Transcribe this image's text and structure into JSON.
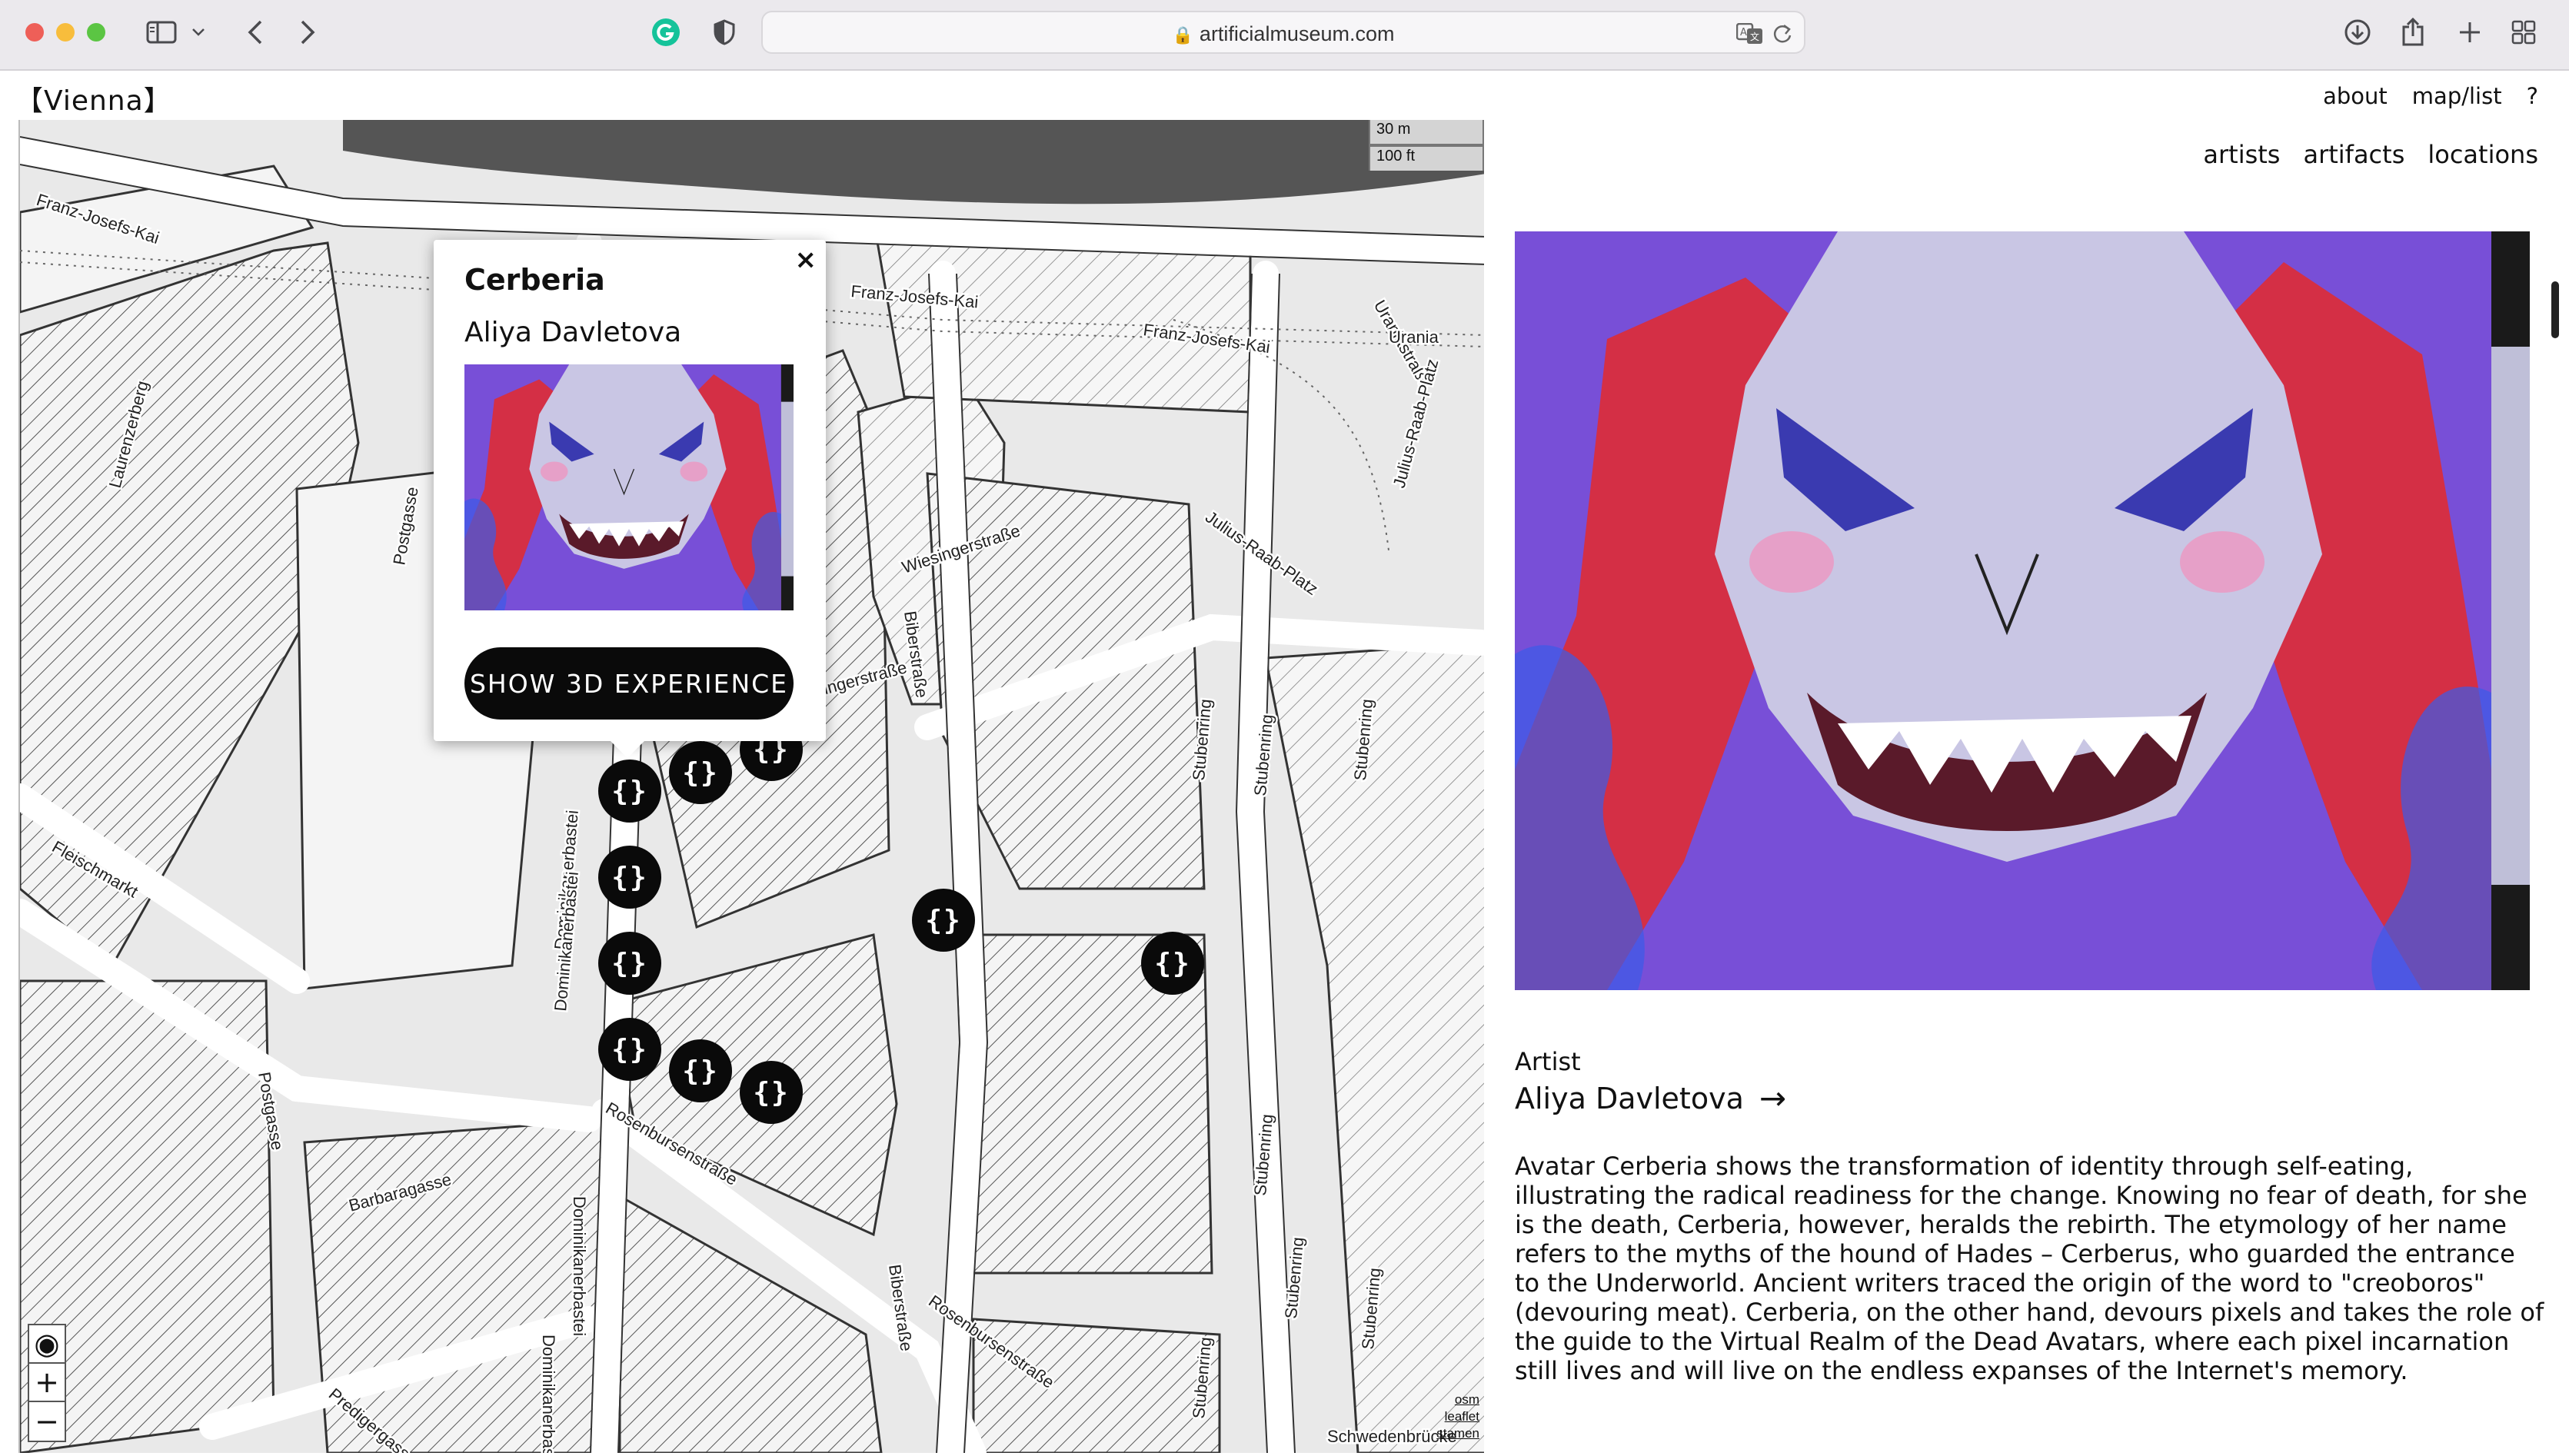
{
  "browser": {
    "url": "artificialmuseum.com"
  },
  "header": {
    "city": "【Vienna】",
    "nav": {
      "about": "about",
      "map_list": "map/list",
      "help": "?"
    },
    "subnav": {
      "artists": "artists",
      "artifacts": "artifacts",
      "locations": "locations"
    }
  },
  "map": {
    "scale": {
      "metric": "30 m",
      "imperial": "100 ft"
    },
    "zoom": {
      "locate": "◉",
      "in": "+",
      "out": "−"
    },
    "attribution": [
      "osm",
      "leaflet",
      "stamen"
    ],
    "marker_glyph": "{}",
    "streets": [
      "Franz-Josefs-Kai",
      "Franz-Josefs-Kai",
      "Franz-Josefs-Kai",
      "Uraniastraße",
      "Urania",
      "Julius-Raab-Platz",
      "Julius-Raab-Platz",
      "Laurenzerberg",
      "Postgasse",
      "Wiesingerstraße",
      "Biberstraße",
      "Stubenring",
      "Stubenring",
      "Stubenring",
      "Fleischmarkt",
      "Dominikanerbastei",
      "Dominikanerbastei",
      "Rosenbursenstraße",
      "Rosenbursenstraße",
      "Barbaragasse",
      "Predigergasse",
      "Postgasse",
      "Biberstraße",
      "Stubenring",
      "Stubenring",
      "Stubenring",
      "Stubenring",
      "Dominikanerbastei",
      "Dominikanerbastei",
      "Wiesingerstraße",
      "Schwedenbrücke"
    ]
  },
  "popup": {
    "title": "Cerberia",
    "artist": "Aliya Davletova",
    "button": "SHOW 3D EXPERIENCE",
    "close": "×"
  },
  "detail": {
    "artist_label": "Artist",
    "artist_name": "Aliya Davletova",
    "artist_arrow": "→",
    "description": "Avatar Cerberia shows the transformation of identity through self-eating, illustrating the radical readiness for the change. Knowing no fear of death, for she is the death, Cerberia, however, heralds the rebirth. The etymology of her name refers to the myths of the hound of Hades – Cerberus, who guarded the entrance to the Underworld. Ancient writers traced the origin of the word to \"creoboros\" (devouring meat). Cerberia, on the other hand, devours pixels and takes the role of the guide to the Virtual Realm of the Dead Avatars, where each pixel incarnation still lives and will live on the endless expanses of the Internet's memory."
  },
  "colors": {
    "artwork_bg": "#7c4fd8",
    "artwork_face": "#c9c6e4",
    "artwork_red": "#d8314a",
    "marker": "#0a0a0a"
  }
}
